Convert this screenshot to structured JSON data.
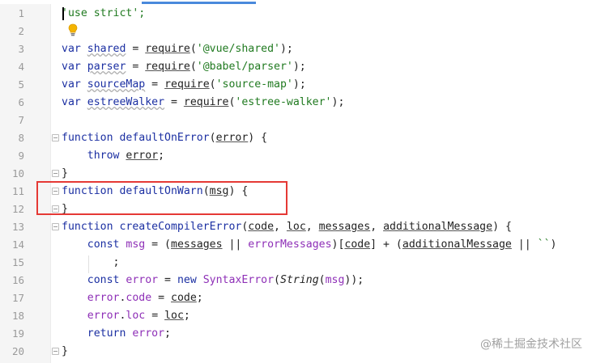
{
  "editor": {
    "line_numbers": [
      "1",
      "2",
      "3",
      "4",
      "5",
      "6",
      "7",
      "8",
      "9",
      "10",
      "11",
      "12",
      "13",
      "14",
      "15",
      "16",
      "17",
      "18",
      "19",
      "20"
    ],
    "lines": [
      [
        {
          "t": "'use strict';",
          "c": "str"
        }
      ],
      [],
      [
        {
          "t": "var ",
          "c": "kw"
        },
        {
          "t": "shared",
          "c": "id wavy"
        },
        {
          "t": " = ",
          "c": "dark"
        },
        {
          "t": "require",
          "c": "dark ul"
        },
        {
          "t": "(",
          "c": "dark"
        },
        {
          "t": "'@vue/shared'",
          "c": "str"
        },
        {
          "t": ");",
          "c": "dark"
        }
      ],
      [
        {
          "t": "var ",
          "c": "kw"
        },
        {
          "t": "parser",
          "c": "id wavy"
        },
        {
          "t": " = ",
          "c": "dark"
        },
        {
          "t": "require",
          "c": "dark ul"
        },
        {
          "t": "(",
          "c": "dark"
        },
        {
          "t": "'@babel/parser'",
          "c": "str"
        },
        {
          "t": ");",
          "c": "dark"
        }
      ],
      [
        {
          "t": "var ",
          "c": "kw"
        },
        {
          "t": "sourceMap",
          "c": "id wavy"
        },
        {
          "t": " = ",
          "c": "dark"
        },
        {
          "t": "require",
          "c": "dark ul"
        },
        {
          "t": "(",
          "c": "dark"
        },
        {
          "t": "'source-map'",
          "c": "str"
        },
        {
          "t": ");",
          "c": "dark"
        }
      ],
      [
        {
          "t": "var ",
          "c": "kw"
        },
        {
          "t": "estreeWalker",
          "c": "id wavy"
        },
        {
          "t": " = ",
          "c": "dark"
        },
        {
          "t": "require",
          "c": "dark ul"
        },
        {
          "t": "(",
          "c": "dark"
        },
        {
          "t": "'estree-walker'",
          "c": "str"
        },
        {
          "t": ");",
          "c": "dark"
        }
      ],
      [],
      [
        {
          "t": "function ",
          "c": "kw"
        },
        {
          "t": "defaultOnError",
          "c": "id"
        },
        {
          "t": "(",
          "c": "dark"
        },
        {
          "t": "error",
          "c": "dark ul"
        },
        {
          "t": ") {",
          "c": "dark"
        }
      ],
      [
        {
          "t": "    ",
          "c": "dark"
        },
        {
          "t": "throw ",
          "c": "kw"
        },
        {
          "t": "error",
          "c": "dark ul"
        },
        {
          "t": ";",
          "c": "dark"
        }
      ],
      [
        {
          "t": "}",
          "c": "dark"
        }
      ],
      [
        {
          "t": "function ",
          "c": "kw"
        },
        {
          "t": "defaultOnWarn",
          "c": "id"
        },
        {
          "t": "(",
          "c": "dark"
        },
        {
          "t": "msg",
          "c": "dark ul"
        },
        {
          "t": ") {",
          "c": "dark"
        }
      ],
      [
        {
          "t": "}",
          "c": "dark"
        }
      ],
      [
        {
          "t": "function ",
          "c": "kw"
        },
        {
          "t": "createCompilerError",
          "c": "id"
        },
        {
          "t": "(",
          "c": "dark"
        },
        {
          "t": "code",
          "c": "dark ul"
        },
        {
          "t": ", ",
          "c": "dark"
        },
        {
          "t": "loc",
          "c": "dark ul"
        },
        {
          "t": ", ",
          "c": "dark"
        },
        {
          "t": "messages",
          "c": "dark ul"
        },
        {
          "t": ", ",
          "c": "dark"
        },
        {
          "t": "additionalMessage",
          "c": "dark ul"
        },
        {
          "t": ") {",
          "c": "dark"
        }
      ],
      [
        {
          "t": "    ",
          "c": "dark"
        },
        {
          "t": "const ",
          "c": "kw"
        },
        {
          "t": "msg",
          "c": "purple"
        },
        {
          "t": " = (",
          "c": "dark"
        },
        {
          "t": "messages",
          "c": "dark ul"
        },
        {
          "t": " || ",
          "c": "dark"
        },
        {
          "t": "errorMessages",
          "c": "purple"
        },
        {
          "t": ")[",
          "c": "dark"
        },
        {
          "t": "code",
          "c": "dark ul"
        },
        {
          "t": "] + (",
          "c": "dark"
        },
        {
          "t": "additionalMessage",
          "c": "dark ul"
        },
        {
          "t": " || ",
          "c": "dark"
        },
        {
          "t": "``",
          "c": "str"
        },
        {
          "t": ")",
          "c": "dark"
        }
      ],
      [
        {
          "t": "        ;",
          "c": "dark"
        }
      ],
      [
        {
          "t": "    ",
          "c": "dark"
        },
        {
          "t": "const ",
          "c": "kw"
        },
        {
          "t": "error",
          "c": "purple"
        },
        {
          "t": " = ",
          "c": "dark"
        },
        {
          "t": "new ",
          "c": "kw"
        },
        {
          "t": "SyntaxError",
          "c": "purple"
        },
        {
          "t": "(",
          "c": "dark"
        },
        {
          "t": "String",
          "c": "dark ital"
        },
        {
          "t": "(",
          "c": "dark"
        },
        {
          "t": "msg",
          "c": "purple"
        },
        {
          "t": "));",
          "c": "dark"
        }
      ],
      [
        {
          "t": "    ",
          "c": "dark"
        },
        {
          "t": "error",
          "c": "purple"
        },
        {
          "t": ".",
          "c": "dark"
        },
        {
          "t": "code",
          "c": "purple"
        },
        {
          "t": " = ",
          "c": "dark"
        },
        {
          "t": "code",
          "c": "dark ul"
        },
        {
          "t": ";",
          "c": "dark"
        }
      ],
      [
        {
          "t": "    ",
          "c": "dark"
        },
        {
          "t": "error",
          "c": "purple"
        },
        {
          "t": ".",
          "c": "dark"
        },
        {
          "t": "loc",
          "c": "purple"
        },
        {
          "t": " = ",
          "c": "dark"
        },
        {
          "t": "loc",
          "c": "dark ul"
        },
        {
          "t": ";",
          "c": "dark"
        }
      ],
      [
        {
          "t": "    ",
          "c": "dark"
        },
        {
          "t": "return ",
          "c": "kw"
        },
        {
          "t": "error",
          "c": "purple"
        },
        {
          "t": ";",
          "c": "dark"
        }
      ],
      [
        {
          "t": "}",
          "c": "dark"
        }
      ]
    ]
  },
  "watermark": "@稀土掘金技术社区"
}
